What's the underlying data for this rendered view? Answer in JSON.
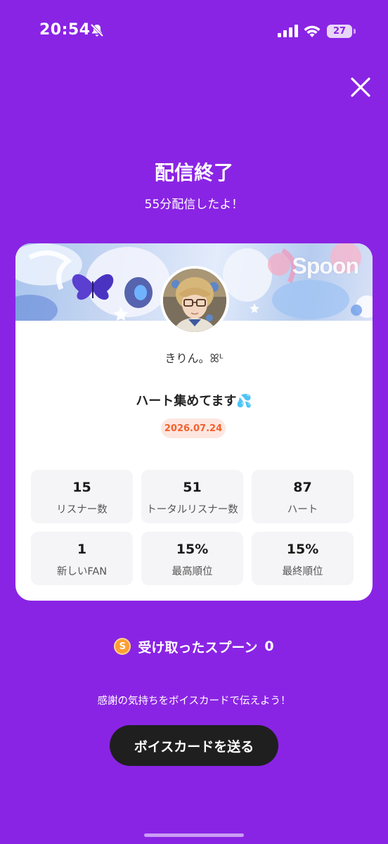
{
  "status_bar": {
    "time": "20:54",
    "battery": "27",
    "icons": [
      "bell-off-icon",
      "signal-icon",
      "wifi-icon",
      "battery-icon"
    ]
  },
  "header": {
    "title": "配信終了",
    "subtitle": "55分配信したよ！"
  },
  "card": {
    "watermark": "Spoon",
    "nickname": "きりん。ꕤᴸ",
    "live_title": "ハート集めてます💦",
    "date": "2026.07.24",
    "stats": [
      {
        "value": "15",
        "label": "リスナー数"
      },
      {
        "value": "51",
        "label": "トータルリスナー数"
      },
      {
        "value": "87",
        "label": "ハート"
      },
      {
        "value": "1",
        "label": "新しいFAN"
      },
      {
        "value": "15%",
        "label": "最高順位"
      },
      {
        "value": "15%",
        "label": "最終順位"
      }
    ]
  },
  "spoons": {
    "coin_symbol": "S",
    "label": "受け取ったスプーン",
    "count": "0"
  },
  "footer": {
    "thanks_text": "感謝の気持ちをボイスカードで伝えよう！",
    "voice_card_button": "ボイスカードを送る"
  },
  "colors": {
    "background": "#8a24e4",
    "date_badge_text": "#f2612d",
    "button_bg": "#1f1f1f",
    "coin": "#ff9d33"
  }
}
